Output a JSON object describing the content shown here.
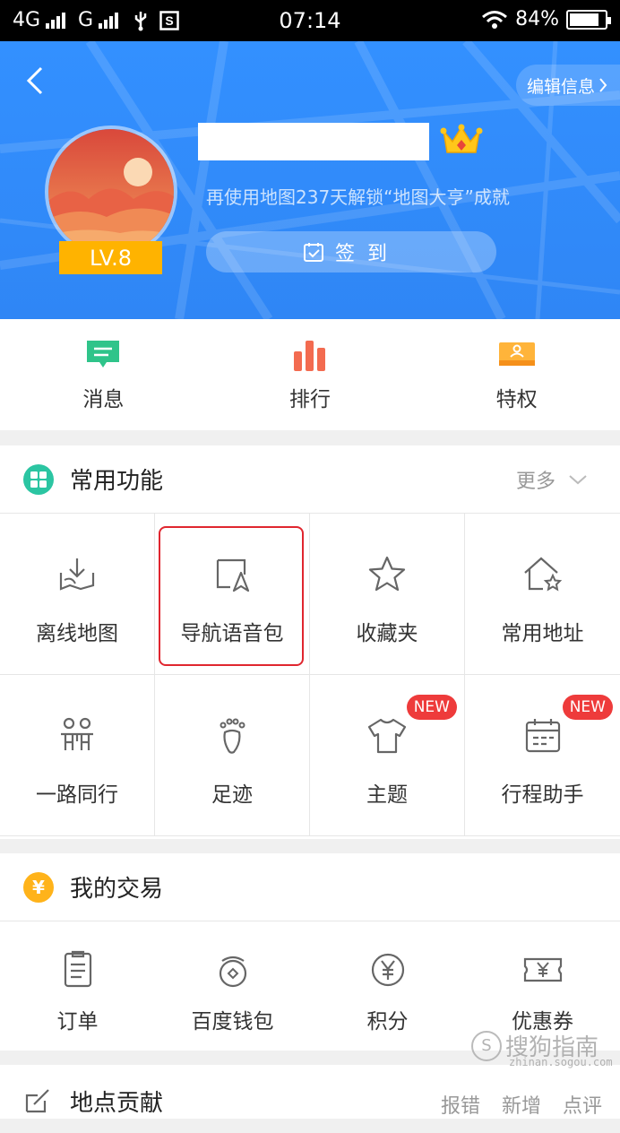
{
  "status_bar": {
    "network_1": "4G",
    "network_2": "G",
    "time": "07:14",
    "battery": "84%",
    "battery_level": 0.84
  },
  "header": {
    "edit_label": "编辑信息",
    "level": "LV.8",
    "promo": "再使用地图237天解锁“地图大亨”成就",
    "signin_label": "签到"
  },
  "quick": [
    {
      "label": "消息",
      "icon": "message-icon"
    },
    {
      "label": "排行",
      "icon": "ranking-icon"
    },
    {
      "label": "特权",
      "icon": "privilege-icon"
    }
  ],
  "common": {
    "title": "常用功能",
    "more": "更多",
    "items": [
      {
        "label": "离线地图",
        "icon": "offline-map-icon"
      },
      {
        "label": "导航语音包",
        "icon": "voice-pack-icon"
      },
      {
        "label": "收藏夹",
        "icon": "star-icon"
      },
      {
        "label": "常用地址",
        "icon": "home-star-icon"
      },
      {
        "label": "一路同行",
        "icon": "people-icon"
      },
      {
        "label": "足迹",
        "icon": "footprint-icon"
      },
      {
        "label": "主题",
        "icon": "shirt-icon",
        "badge": "NEW"
      },
      {
        "label": "行程助手",
        "icon": "calendar-icon",
        "badge": "NEW"
      }
    ]
  },
  "trade": {
    "title": "我的交易",
    "items": [
      {
        "label": "订单",
        "icon": "order-icon"
      },
      {
        "label": "百度钱包",
        "icon": "wallet-icon"
      },
      {
        "label": "积分",
        "icon": "points-icon"
      },
      {
        "label": "优惠券",
        "icon": "coupon-icon"
      }
    ]
  },
  "contrib": {
    "title": "地点贡献",
    "links": [
      "报错",
      "新增",
      "点评"
    ]
  },
  "watermark": {
    "name": "搜狗指南",
    "url": "zhinan.sogou.com"
  },
  "colors": {
    "header_blue": "#3390ff",
    "highlight_red": "#e0262f",
    "badge_red": "#ee3b3b",
    "level_gold": "#ffb300"
  }
}
